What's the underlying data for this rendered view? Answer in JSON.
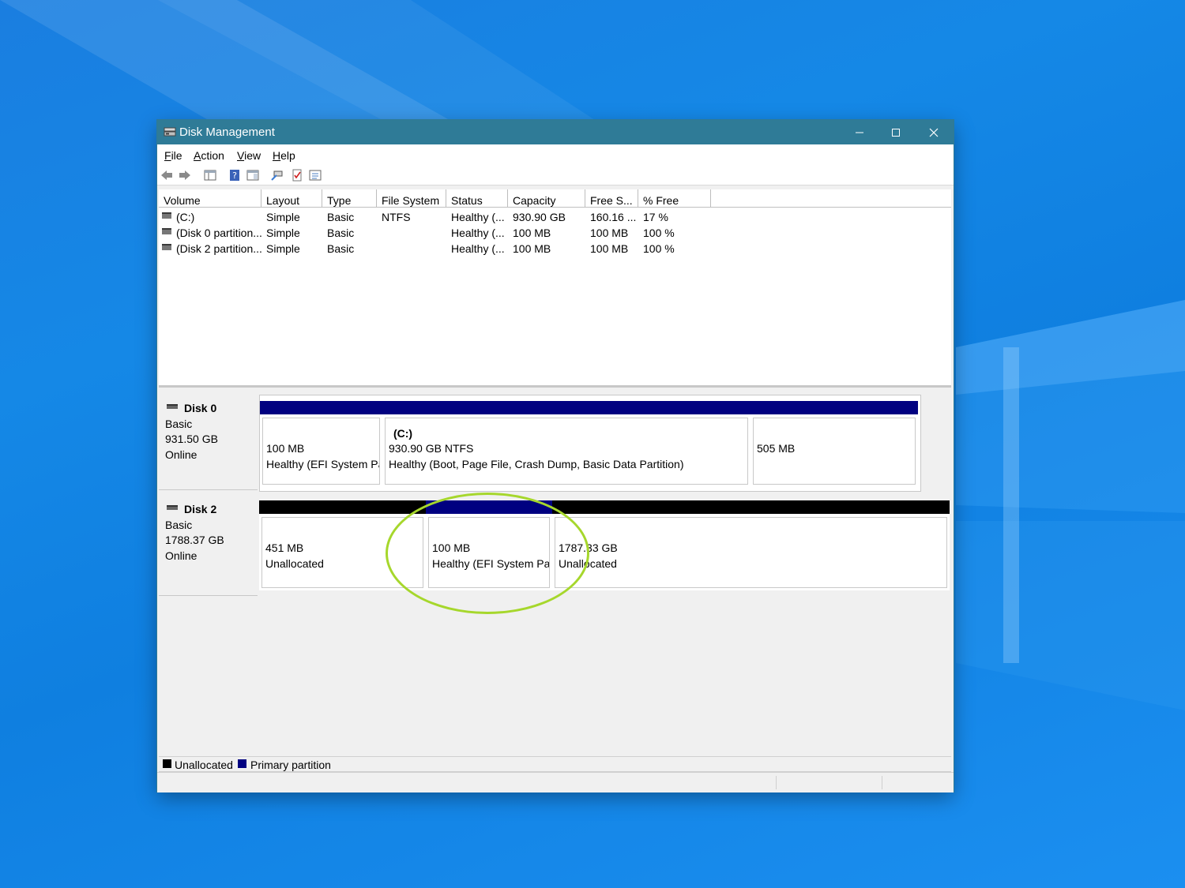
{
  "window": {
    "title": "Disk Management",
    "title_bar_color": "#2f7b97"
  },
  "menu": {
    "items": [
      {
        "label": "File",
        "accel": "F",
        "rest": "ile"
      },
      {
        "label": "Action",
        "accel": "A",
        "rest": "ction"
      },
      {
        "label": "View",
        "accel": "V",
        "rest": "iew"
      },
      {
        "label": "Help",
        "accel": "H",
        "rest": "elp"
      }
    ]
  },
  "toolbar": {
    "icons": [
      "back-arrow-icon",
      "forward-arrow-icon",
      "console-tree-icon",
      "help-icon",
      "properties-icon",
      "rescan-icon",
      "check-icon",
      "settings-list-icon"
    ]
  },
  "volume_list": {
    "columns": [
      "Volume",
      "Layout",
      "Type",
      "File System",
      "Status",
      "Capacity",
      "Free S...",
      "% Free"
    ],
    "rows": [
      [
        "(C:)",
        "Simple",
        "Basic",
        "NTFS",
        "Healthy (...",
        "930.90 GB",
        "160.16 ...",
        "17 %"
      ],
      [
        "(Disk 0 partition...",
        "Simple",
        "Basic",
        "",
        "Healthy (...",
        "100 MB",
        "100 MB",
        "100 %"
      ],
      [
        "(Disk 2 partition...",
        "Simple",
        "Basic",
        "",
        "Healthy (...",
        "100 MB",
        "100 MB",
        "100 %"
      ]
    ]
  },
  "disks": [
    {
      "name": "Disk 0",
      "type": "Basic",
      "size": "931.50 GB",
      "state": "Online",
      "partitions": [
        {
          "title": "",
          "line1": "100 MB",
          "line2": "Healthy (EFI System Pa",
          "kind": "primary"
        },
        {
          "title": "(C:)",
          "line1": "930.90 GB NTFS",
          "line2": "Healthy (Boot, Page File, Crash Dump, Basic Data Partition)",
          "kind": "primary"
        },
        {
          "title": "",
          "line1": "505 MB",
          "line2": "",
          "kind": "primary"
        }
      ]
    },
    {
      "name": "Disk 2",
      "type": "Basic",
      "size": "1788.37 GB",
      "state": "Online",
      "partitions": [
        {
          "title": "",
          "line1": "451 MB",
          "line2": "Unallocated",
          "kind": "unallocated"
        },
        {
          "title": "",
          "line1": "100 MB",
          "line2": "Healthy (EFI System Pa",
          "kind": "primary"
        },
        {
          "title": "",
          "line1": "1787.33 GB",
          "line2": "Unallocated",
          "kind": "unallocated"
        }
      ]
    }
  ],
  "legend": {
    "unallocated": "Unallocated",
    "primary": "Primary partition"
  },
  "colors": {
    "primary_partition": "#000080",
    "unallocated": "#000000",
    "annotation_circle": "#a6d72c"
  }
}
